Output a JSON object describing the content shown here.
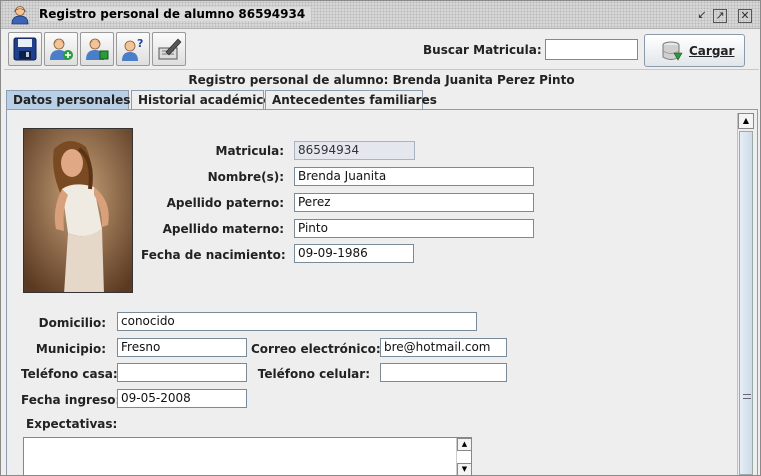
{
  "window": {
    "title": "Registro personal de alumno 86594934"
  },
  "toolbar": {
    "buttons": [
      "save-icon",
      "user-add-icon",
      "user-edit-icon",
      "user-help-icon",
      "edit-icon"
    ],
    "search_label": "Buscar Matricula:",
    "search_value": "",
    "load_label": "Cargar"
  },
  "record_title": "Registro personal de alumno: Brenda Juanita Perez Pinto",
  "tabs": [
    "Datos personales",
    "Historial académico",
    "Antecedentes familiares"
  ],
  "form": {
    "matricula": {
      "label": "Matricula:",
      "value": "86594934"
    },
    "nombres": {
      "label": "Nombre(s):",
      "value": "Brenda Juanita"
    },
    "apellido_paterno": {
      "label": "Apellido paterno:",
      "value": "Perez"
    },
    "apellido_materno": {
      "label": "Apellido materno:",
      "value": "Pinto"
    },
    "fecha_nacimiento": {
      "label": "Fecha de nacimiento:",
      "value": "09-09-1986"
    },
    "domicilio": {
      "label": "Domicilio:",
      "value": "conocido"
    },
    "municipio": {
      "label": "Municipio:",
      "value": "Fresno"
    },
    "correo": {
      "label": "Correo electrónico:",
      "value": "bre@hotmail.com"
    },
    "telefono_casa": {
      "label": "Teléfono casa:",
      "value": ""
    },
    "telefono_celular": {
      "label": "Teléfono celular:",
      "value": ""
    },
    "fecha_ingreso": {
      "label": "Fecha ingreso:",
      "value": "09-05-2008"
    },
    "expectativas": {
      "label": "Expectativas:",
      "value": ""
    }
  },
  "colors": {
    "active_tab": "#b8cfe5",
    "readonly_field": "#e4e8ee"
  }
}
